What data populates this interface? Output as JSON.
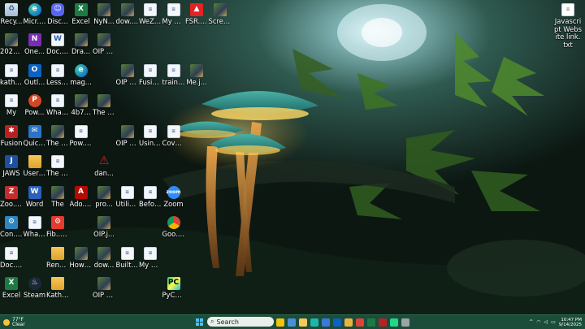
{
  "desktop": {
    "icons": [
      {
        "id": "recycle",
        "label": "Recy...",
        "type": "recycle",
        "glyph": "♻",
        "col": 0,
        "row": 0
      },
      {
        "id": "edge",
        "label": "Micr... Edge",
        "type": "edge",
        "glyph": "e",
        "col": 1,
        "row": 0
      },
      {
        "id": "discord",
        "label": "Disc...",
        "type": "discord",
        "glyph": "☺",
        "col": 2,
        "row": 0
      },
      {
        "id": "excel1",
        "label": "Excel",
        "type": "excel",
        "glyph": "X",
        "col": 3,
        "row": 0
      },
      {
        "id": "nyn",
        "label": "NyN...",
        "type": "img",
        "glyph": "",
        "col": 4,
        "row": 0
      },
      {
        "id": "dow1",
        "label": "dow... (1).jpg",
        "type": "img",
        "glyph": "",
        "col": 5,
        "row": 0
      },
      {
        "id": "wez",
        "label": "WeZ... and ...",
        "type": "file",
        "glyph": "≡",
        "col": 6,
        "row": 0
      },
      {
        "id": "myknow1",
        "label": "My kno...",
        "type": "file",
        "glyph": "≡",
        "col": 7,
        "row": 0
      },
      {
        "id": "fsr",
        "label": "FSR... 3.0",
        "type": "fsr",
        "glyph": "▲",
        "col": 8,
        "row": 0
      },
      {
        "id": "scre",
        "label": "Scre... 202...",
        "type": "img",
        "glyph": "",
        "col": 9,
        "row": 0
      },
      {
        "id": "img2025a",
        "label": "2025...",
        "type": "img",
        "glyph": "",
        "col": 0,
        "row": 1
      },
      {
        "id": "onenote",
        "label": "One...",
        "type": "onenote",
        "glyph": "N",
        "col": 1,
        "row": 1
      },
      {
        "id": "doc1",
        "label": "Doc... R...",
        "type": "docx",
        "glyph": "W",
        "col": 2,
        "row": 1
      },
      {
        "id": "dra",
        "label": "Dra...",
        "type": "img",
        "glyph": "",
        "col": 3,
        "row": 1
      },
      {
        "id": "oip1",
        "label": "OIP (1).jpg",
        "type": "img",
        "glyph": "",
        "col": 4,
        "row": 1
      },
      {
        "id": "kath1",
        "label": "kath... nr...",
        "type": "file",
        "glyph": "≡",
        "col": 0,
        "row": 2
      },
      {
        "id": "outlook1",
        "label": "Outl...",
        "type": "outlook",
        "glyph": "O",
        "col": 1,
        "row": 2
      },
      {
        "id": "less",
        "label": "Less... 2...",
        "type": "file",
        "glyph": "≡",
        "col": 2,
        "row": 2
      },
      {
        "id": "mag",
        "label": "mag...",
        "type": "edge",
        "glyph": "e",
        "col": 3,
        "row": 2
      },
      {
        "id": "oip3",
        "label": "OIP (3).jpg",
        "type": "img",
        "glyph": "",
        "col": 5,
        "row": 2
      },
      {
        "id": "fusiontrain",
        "label": "Fusion and ...",
        "type": "file",
        "glyph": "≡",
        "col": 6,
        "row": 2
      },
      {
        "id": "traini",
        "label": "traini... note ...",
        "type": "file",
        "glyph": "≡",
        "col": 7,
        "row": 2
      },
      {
        "id": "mejpg",
        "label": "Me.j...",
        "type": "img",
        "glyph": "",
        "col": 8,
        "row": 2
      },
      {
        "id": "my",
        "label": "My",
        "type": "file",
        "glyph": "≡",
        "col": 0,
        "row": 3
      },
      {
        "id": "pow1",
        "label": "Pow...",
        "type": "ppt",
        "glyph": "P",
        "col": 1,
        "row": 3
      },
      {
        "id": "whati1",
        "label": "What I...",
        "type": "file",
        "glyph": "≡",
        "col": 2,
        "row": 3
      },
      {
        "id": "b4b7",
        "label": "4b7...",
        "type": "img",
        "glyph": "",
        "col": 3,
        "row": 3
      },
      {
        "id": "theda",
        "label": "The Dan...",
        "type": "img",
        "glyph": "",
        "col": 4,
        "row": 3
      },
      {
        "id": "fusion",
        "label": "Fusion",
        "type": "fusion",
        "glyph": "✱",
        "col": 0,
        "row": 4
      },
      {
        "id": "quick",
        "label": "Quick Assist",
        "type": "quick",
        "glyph": "✉",
        "col": 1,
        "row": 4
      },
      {
        "id": "the2",
        "label": "The J...",
        "type": "img",
        "glyph": "",
        "col": 2,
        "row": 4
      },
      {
        "id": "pow2",
        "label": "Pow... Pres...",
        "type": "file",
        "glyph": "≡",
        "col": 3,
        "row": 4
      },
      {
        "id": "oip4",
        "label": "OIP (4).jpg",
        "type": "img",
        "glyph": "",
        "col": 5,
        "row": 4
      },
      {
        "id": "using",
        "label": "Using Wor...",
        "type": "file",
        "glyph": "≡",
        "col": 6,
        "row": 4
      },
      {
        "id": "cove",
        "label": "Cove... Kath...",
        "type": "file",
        "glyph": "≡",
        "col": 7,
        "row": 4
      },
      {
        "id": "jaws",
        "label": "JAWS",
        "type": "jaws",
        "glyph": "J",
        "col": 0,
        "row": 5
      },
      {
        "id": "users",
        "label": "Users S...",
        "type": "folder",
        "glyph": "",
        "col": 1,
        "row": 5
      },
      {
        "id": "the3",
        "label": "The L...",
        "type": "file",
        "glyph": "≡",
        "col": 2,
        "row": 5
      },
      {
        "id": "dan",
        "label": "dan...",
        "type": "warn",
        "glyph": "⚠",
        "col": 4,
        "row": 5
      },
      {
        "id": "zotero",
        "label": "Zoo... 7",
        "type": "zotero",
        "glyph": "Z",
        "col": 0,
        "row": 6
      },
      {
        "id": "word",
        "label": "Word",
        "type": "word",
        "glyph": "W",
        "col": 1,
        "row": 6
      },
      {
        "id": "the4",
        "label": "The",
        "type": "img",
        "glyph": "",
        "col": 2,
        "row": 6
      },
      {
        "id": "acro",
        "label": "Ado... Acro...",
        "type": "acro",
        "glyph": "A",
        "col": 3,
        "row": 6
      },
      {
        "id": "pro",
        "label": "pro...",
        "type": "img",
        "glyph": "",
        "col": 4,
        "row": 6
      },
      {
        "id": "utiliz",
        "label": "Utiliz... Assi...",
        "type": "file",
        "glyph": "≡",
        "col": 5,
        "row": 6
      },
      {
        "id": "before",
        "label": "Before Outl...",
        "type": "file",
        "glyph": "≡",
        "col": 6,
        "row": 6
      },
      {
        "id": "zoom",
        "label": "Zoom",
        "type": "zoom",
        "glyph": "zoom",
        "col": 7,
        "row": 6
      },
      {
        "id": "control",
        "label": "Con... Panel",
        "type": "control",
        "glyph": "⚙",
        "col": 0,
        "row": 7
      },
      {
        "id": "whati2",
        "label": "What I want...",
        "type": "file",
        "glyph": "≡",
        "col": 1,
        "row": 7
      },
      {
        "id": "fib",
        "label": "Fib... XL",
        "type": "red",
        "glyph": "⚙",
        "col": 2,
        "row": 7
      },
      {
        "id": "oipj",
        "label": "OIP.j...",
        "type": "img",
        "glyph": "",
        "col": 4,
        "row": 7
      },
      {
        "id": "chrome",
        "label": "Goo... Chro...",
        "type": "chrome",
        "glyph": "",
        "col": 7,
        "row": 7
      },
      {
        "id": "doc2",
        "label": "Doc... 1",
        "type": "file",
        "glyph": "≡",
        "col": 0,
        "row": 8
      },
      {
        "id": "rena",
        "label": "Rena... Train...",
        "type": "folder",
        "glyph": "",
        "col": 2,
        "row": 8
      },
      {
        "id": "howto",
        "label": "How to pl...",
        "type": "img",
        "glyph": "",
        "col": 3,
        "row": 8
      },
      {
        "id": "dow2",
        "label": "dow...",
        "type": "img",
        "glyph": "",
        "col": 4,
        "row": 8
      },
      {
        "id": "builtin",
        "label": "Built in zo...",
        "type": "file",
        "glyph": "≡",
        "col": 5,
        "row": 8
      },
      {
        "id": "myknow2",
        "label": "My kno...",
        "type": "file",
        "glyph": "≡",
        "col": 6,
        "row": 8
      },
      {
        "id": "excel2",
        "label": "Excel",
        "type": "excel",
        "glyph": "X",
        "col": 0,
        "row": 9
      },
      {
        "id": "steam",
        "label": "Steam",
        "type": "steam",
        "glyph": "♨",
        "col": 1,
        "row": 9
      },
      {
        "id": "kath2",
        "label": "Kath... Train...",
        "type": "folder",
        "glyph": "",
        "col": 2,
        "row": 9
      },
      {
        "id": "oip2",
        "label": "OIP (2).jpg",
        "type": "img",
        "glyph": "",
        "col": 4,
        "row": 9
      },
      {
        "id": "pycharm",
        "label": "PyCh... 2025...",
        "type": "pycharm",
        "glyph": "PC",
        "col": 7,
        "row": 9
      }
    ],
    "right_icon": {
      "label": "Javascript Website link.txt",
      "glyph": "≡"
    }
  },
  "taskbar": {
    "weather_temp": "77°F",
    "weather_desc": "Clear",
    "search_placeholder": "Search",
    "apps": [
      {
        "name": "search-highlight",
        "color": "#f1c40f"
      },
      {
        "name": "task-view",
        "color": "#4a90d9"
      },
      {
        "name": "file-explorer",
        "color": "#f6c85a"
      },
      {
        "name": "edge",
        "color": "#1db6a8"
      },
      {
        "name": "store",
        "color": "#3c78d8"
      },
      {
        "name": "outlook",
        "color": "#0b62c2"
      },
      {
        "name": "folder",
        "color": "#e8b441"
      },
      {
        "name": "chrome",
        "color": "#db4437"
      },
      {
        "name": "excel",
        "color": "#1e7a44"
      },
      {
        "name": "fusion",
        "color": "#b8211f"
      },
      {
        "name": "pycharm",
        "color": "#21d789"
      },
      {
        "name": "settings",
        "color": "#9aa5a8"
      }
    ],
    "time": "10:47 PM",
    "date": "9/14/2025"
  },
  "colors": {
    "taskbar": "#1c4d3b",
    "accent": "#4cc2ff"
  }
}
